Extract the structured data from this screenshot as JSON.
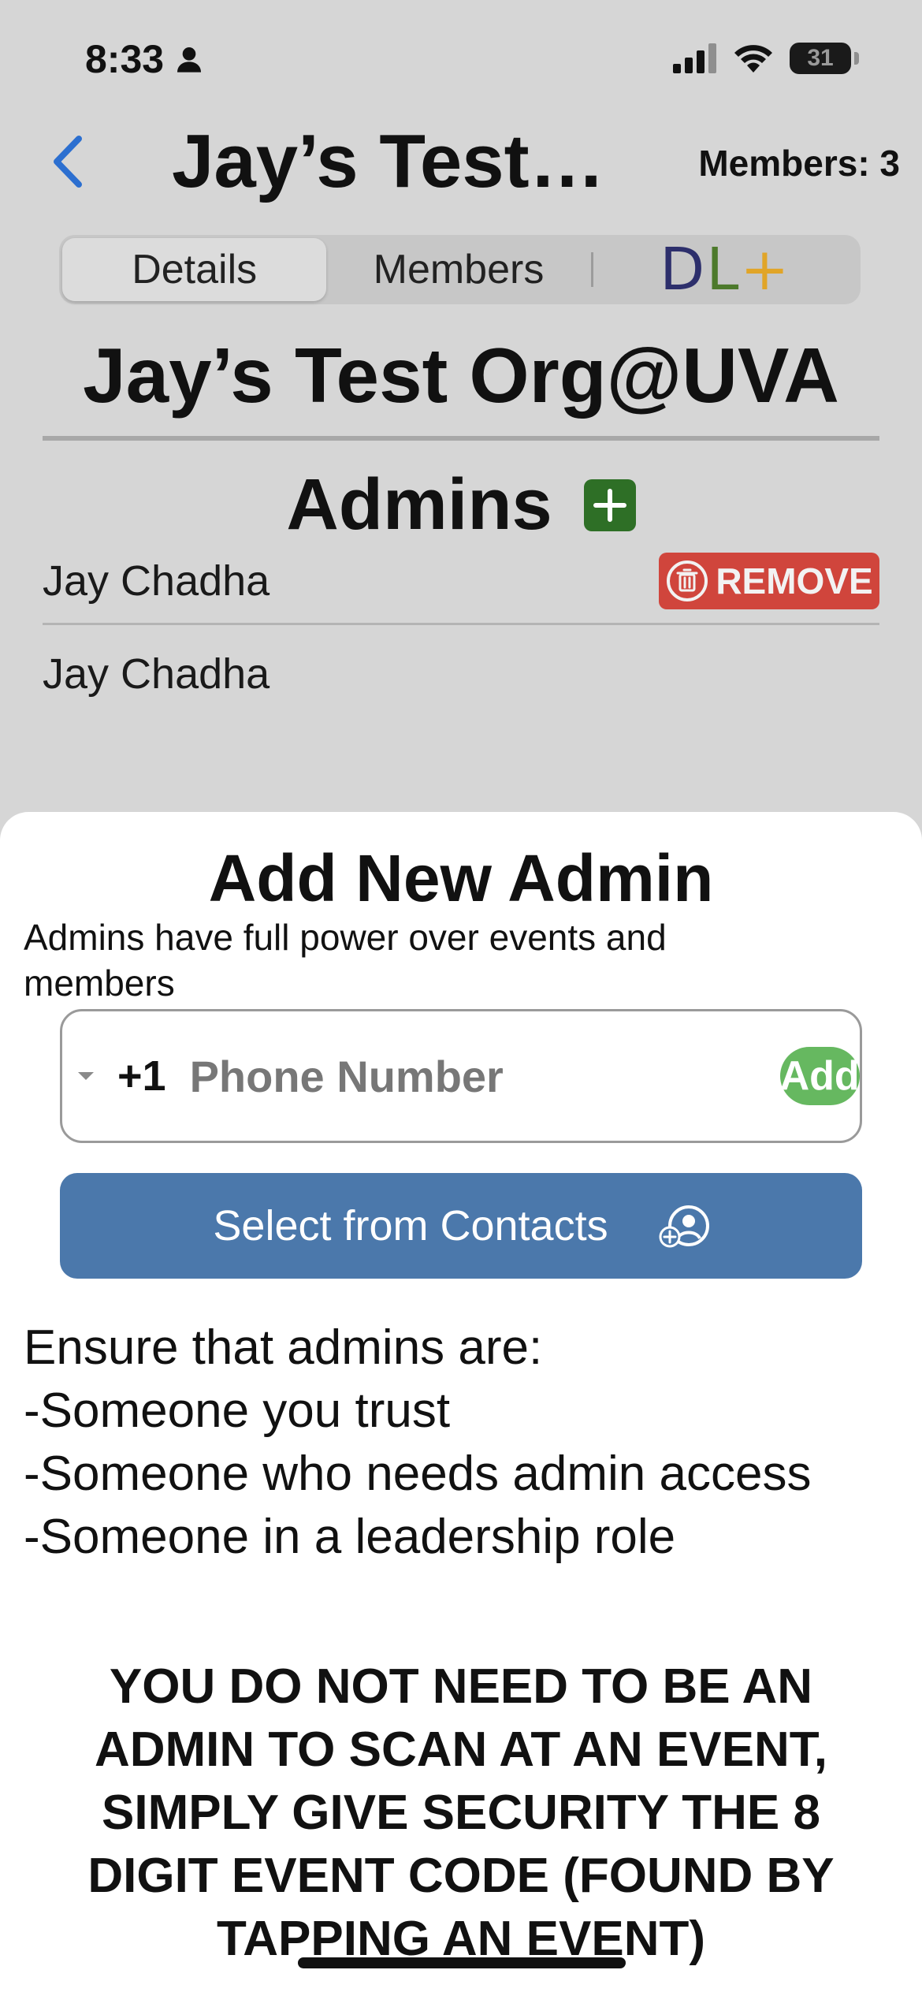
{
  "status_bar": {
    "time": "8:33",
    "battery": "31"
  },
  "nav": {
    "title": "Jay’s Test…",
    "members_count": "Members: 3"
  },
  "tabs": [
    {
      "label": "Details",
      "active": true
    },
    {
      "label": "Members",
      "active": false
    }
  ],
  "logo": {
    "d": "D",
    "l": "L",
    "plus": "+"
  },
  "org": {
    "name": "Jay’s Test Org@UVA"
  },
  "admins": {
    "heading": "Admins",
    "rows": [
      {
        "name": "Jay Chadha",
        "remove_label": "REMOVE"
      },
      {
        "name": "Jay Chadha"
      }
    ]
  },
  "sheet": {
    "title": "Add New Admin",
    "subtitle": "Admins have full power over events and members",
    "country_code": "+1",
    "phone_placeholder": "Phone Number",
    "add_label": "Add",
    "contacts_label": "Select from Contacts",
    "instructions": [
      "Ensure that admins are:",
      "-Someone you trust",
      "-Someone who needs admin access",
      "-Someone in a leadership role"
    ],
    "warning": "YOU DO NOT NEED TO BE AN ADMIN TO SCAN AT AN EVENT, SIMPLY GIVE SECURITY THE 8 DIGIT EVENT CODE (FOUND BY TAPPING AN EVENT)"
  },
  "colors": {
    "accent_blue": "#4b78ab",
    "add_green": "#66b860",
    "admin_add_green": "#2e6f26",
    "remove_red": "#d0453c",
    "back_blue": "#2c6fd0"
  },
  "icons": [
    "person-icon",
    "signal-icon",
    "wifi-icon",
    "battery-icon",
    "back-chevron-icon",
    "plus-icon",
    "trash-icon",
    "dropdown-caret-icon",
    "contact-add-icon"
  ]
}
